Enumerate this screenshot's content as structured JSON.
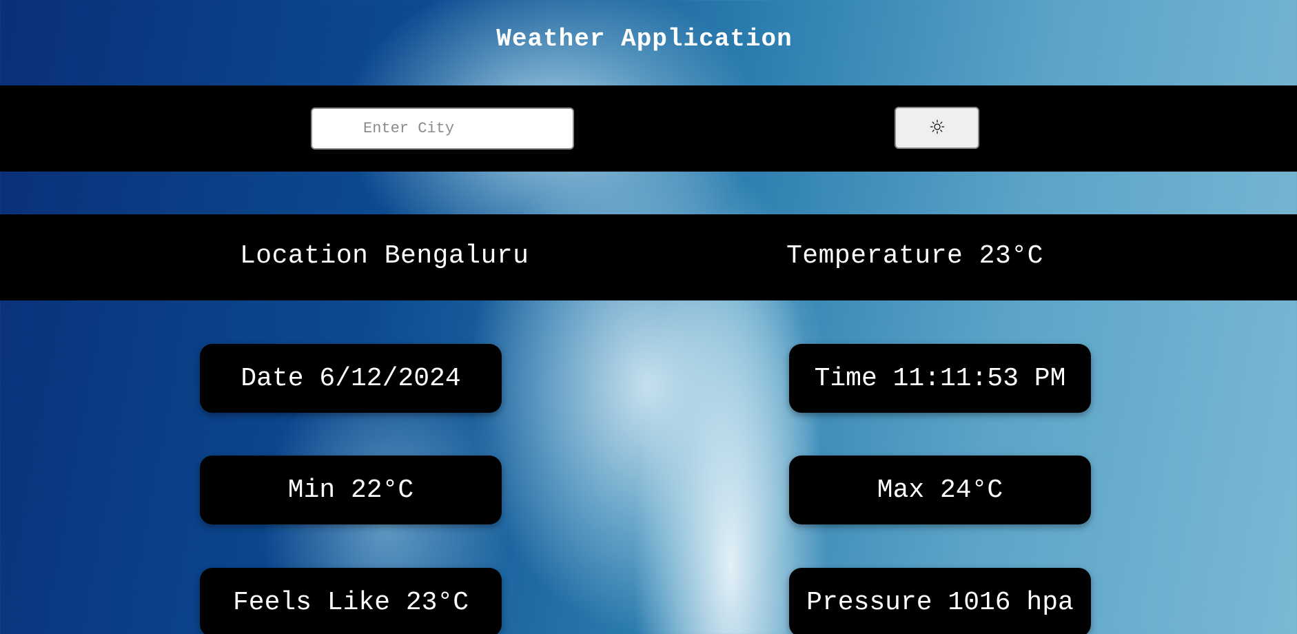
{
  "header": {
    "title": "Weather Application"
  },
  "search": {
    "placeholder": "Enter City",
    "value": "",
    "theme_toggle_icon": "sun-icon"
  },
  "summary": {
    "location_label": "Location",
    "location_value": "Bengaluru",
    "temperature_label": "Temperature",
    "temperature_value": "23°C"
  },
  "cards": {
    "date": {
      "label": "Date",
      "value": "6/12/2024"
    },
    "time": {
      "label": "Time",
      "value": "11:11:53 PM"
    },
    "min": {
      "label": "Min",
      "value": "22°C"
    },
    "max": {
      "label": "Max",
      "value": "24°C"
    },
    "feels_like": {
      "label": "Feels Like",
      "value": "23°C"
    },
    "pressure": {
      "label": "Pressure",
      "value": "1016 hpa"
    }
  },
  "colors": {
    "band_background": "#000000",
    "text": "#ffffff",
    "input_background": "#ffffff",
    "button_background": "#efefef"
  }
}
